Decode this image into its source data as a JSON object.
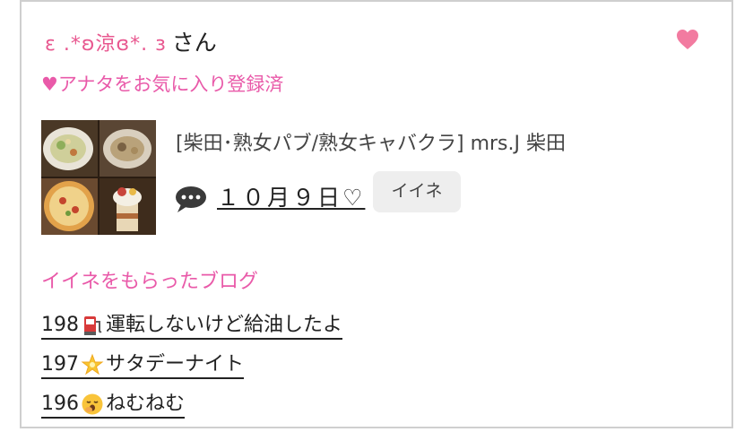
{
  "user": {
    "name": "ε .*ʚ涼ɞ*. з",
    "suffix": "さん"
  },
  "favorite_status": "♥アナタをお気に入り登録済",
  "post": {
    "shop_name": "[柴田･熟女パブ/熟女キャバクラ]  mrs.J 柴田",
    "date_label": "１０月９日♡",
    "iine_label": "イイネ",
    "thumbnail_icon": "food-photo-collage"
  },
  "liked_blogs": {
    "title": "イイネをもらったブログ",
    "items": [
      {
        "number": "198",
        "emoji": "fuel-pump",
        "title": "運転しないけど給油したよ"
      },
      {
        "number": "197",
        "emoji": "glowing-star",
        "title": "サタデーナイト"
      },
      {
        "number": "196",
        "emoji": "yawning-face",
        "title": "ねむねむ"
      }
    ]
  },
  "colors": {
    "accent_pink": "#e95aa9",
    "heart_pink": "#f27ba0",
    "name_pink": "#e8578f",
    "border": "#cfcfcf",
    "button_bg": "#eeeeee"
  }
}
